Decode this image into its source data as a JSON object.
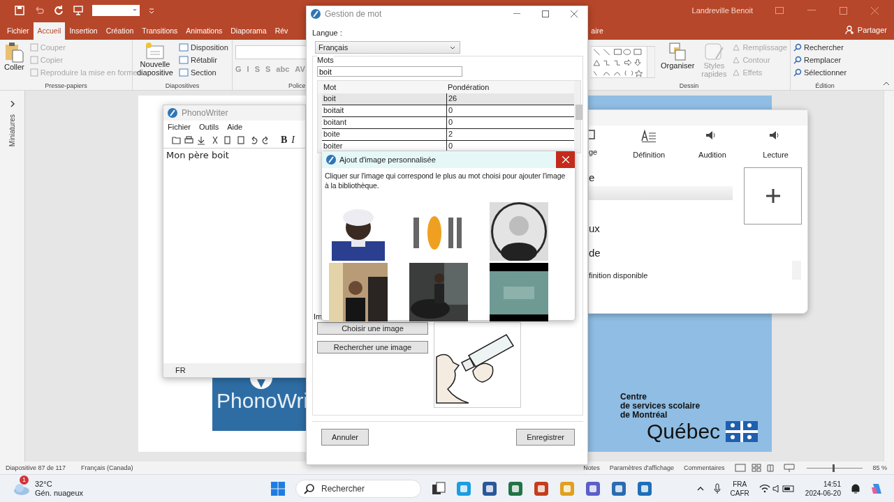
{
  "ppt": {
    "user": "Landreville Benoit",
    "tabs": [
      {
        "label": "Fichier",
        "selected": false
      },
      {
        "label": "Accueil",
        "selected": true
      },
      {
        "label": "Insertion",
        "selected": false
      },
      {
        "label": "Création",
        "selected": false
      },
      {
        "label": "Transitions",
        "selected": false
      },
      {
        "label": "Animations",
        "selected": false
      },
      {
        "label": "Diaporama",
        "selected": false
      },
      {
        "label": "Rév",
        "selected": false
      }
    ],
    "tab_fragment": "aire",
    "share": "Partager",
    "ribbon": {
      "clipboard": {
        "title": "Presse-papiers",
        "paste": "Coller",
        "items": [
          {
            "label": "Couper",
            "disabled": true
          },
          {
            "label": "Copier",
            "disabled": true
          },
          {
            "label": "Reproduire la mise en forme",
            "disabled": true
          }
        ]
      },
      "slides": {
        "title": "Diapositives",
        "new_slide": [
          "Nouvelle",
          "diapositive"
        ],
        "items": [
          {
            "label": "Disposition",
            "disabled": false
          },
          {
            "label": "Rétablir",
            "disabled": false
          },
          {
            "label": "Section",
            "disabled": false
          }
        ]
      },
      "font": {
        "title": "Police",
        "buttons": [
          "G",
          "I",
          "S",
          "S",
          "abc",
          "AV"
        ]
      },
      "drawing": {
        "title": "Dessin",
        "arrange": "Organiser",
        "quick_styles": [
          "Styles",
          "rapides"
        ],
        "items": [
          {
            "label": "Remplissage",
            "disabled": true
          },
          {
            "label": "Contour",
            "disabled": true
          },
          {
            "label": "Effets",
            "disabled": true
          }
        ]
      },
      "editing": {
        "title": "Édition",
        "items": [
          {
            "label": "Rechercher",
            "disabled": false
          },
          {
            "label": "Remplacer",
            "disabled": false
          },
          {
            "label": "Sélectionner",
            "disabled": false
          }
        ]
      }
    },
    "side_pane": "Miniatures",
    "slide": {
      "logo_text": "PhonoWri",
      "org": [
        "Centre",
        "de services scolaire",
        "de Montréal"
      ],
      "province": "Québec"
    },
    "status": {
      "slide_info": "Diapositive 87 de 117",
      "language": "Français (Canada)",
      "notes": "Notes",
      "display": "Paramètres d'affichage",
      "comments": "Commentaires",
      "zoom": "85 %",
      "zoom_slider": {
        "level": 0.47
      }
    }
  },
  "phonowriter": {
    "title": "PhonoWriter",
    "menu": [
      "Fichier",
      "Outils",
      "Aide"
    ],
    "format_buttons": [
      "B",
      "I"
    ],
    "text": "Mon père boit",
    "language": "FR"
  },
  "word_dialog": {
    "title": "Gestion de mot",
    "language_label": "Langue :",
    "language": "Français",
    "words_label": "Mots",
    "search": "boit",
    "columns": [
      "Mot",
      "Pondération"
    ],
    "rows": [
      {
        "word": "boit",
        "weight": "26",
        "selected": true
      },
      {
        "word": "boitait",
        "weight": "0",
        "selected": false
      },
      {
        "word": "boitant",
        "weight": "0",
        "selected": false
      },
      {
        "word": "boite",
        "weight": "2",
        "selected": false
      },
      {
        "word": "boiter",
        "weight": "0",
        "selected": false
      }
    ],
    "image_label": "Im",
    "buttons": [
      "Choisir une image",
      "Rechercher une image"
    ],
    "cancel": "Annuler",
    "save": "Enregistrer"
  },
  "image_popup": {
    "title": "Ajout d'image personnalisée",
    "instructions": "Cliquer sur l'image qui correspond le plus au mot choisi pour ajouter l'image à la bibliothèque."
  },
  "side_panel": {
    "tabs": [
      {
        "label": "ge"
      },
      {
        "label": "Définition"
      },
      {
        "label": "Audition"
      },
      {
        "label": "Lecture"
      }
    ],
    "heading_fragment": "e",
    "line_fragments": [
      "ux",
      "de"
    ],
    "definition_note": "finition disponible"
  },
  "taskbar": {
    "weather": {
      "temp": "32°C",
      "desc": "Gén. nuageux",
      "badge": "1"
    },
    "search": {
      "placeholder": "Rechercher"
    },
    "lang": [
      "FRA",
      "CAFR"
    ],
    "time": "14:51",
    "date": "2024-06-20"
  }
}
